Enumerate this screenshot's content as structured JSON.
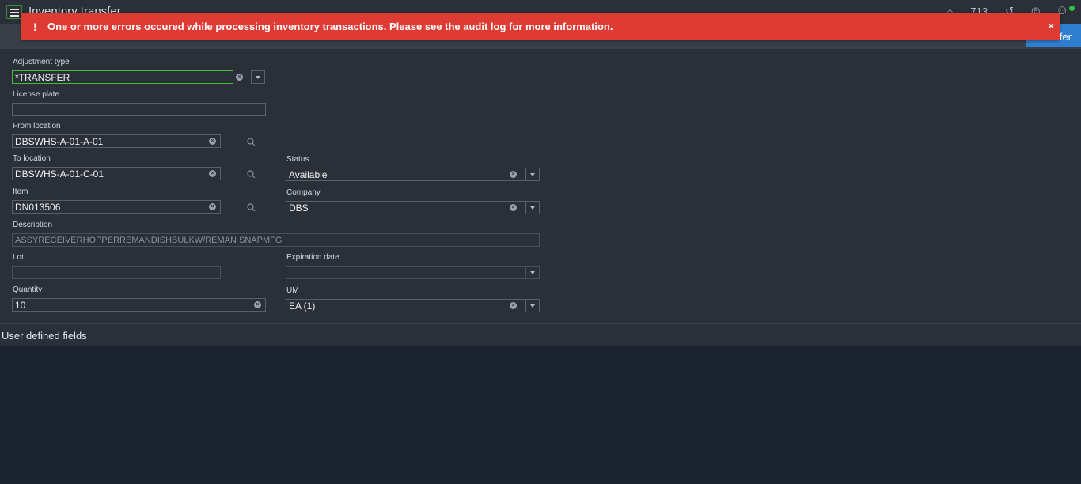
{
  "app": {
    "title": "Inventory transfer",
    "count": "713",
    "action_label": "fer"
  },
  "icons": {
    "menu": "hamburger-icon",
    "home": "home-icon",
    "history": "history-icon",
    "help": "help-icon",
    "user": "user-icon",
    "search": "search-icon",
    "clear": "clear-icon",
    "dropdown": "chevron-down-icon",
    "error": "exclamation-icon",
    "close": "close-icon"
  },
  "error": {
    "message": "One or more errors occured while processing inventory transactions. Please see the audit log for more information.",
    "icon": "!",
    "close": "×"
  },
  "form": {
    "adjustment_type": {
      "label": "Adjustment type",
      "value": "*TRANSFER"
    },
    "license_plate": {
      "label": "License plate",
      "value": ""
    },
    "from_location": {
      "label": "From location",
      "value": "DBSWHS-A-01-A-01"
    },
    "to_location": {
      "label": "To location",
      "value": "DBSWHS-A-01-C-01"
    },
    "status": {
      "label": "Status",
      "value": "Available"
    },
    "item": {
      "label": "Item",
      "value": "DN013506"
    },
    "company": {
      "label": "Company",
      "value": "DBS"
    },
    "description": {
      "label": "Description",
      "value": "ASSYRECEIVERHOPPERREMANDISHBULKW/REMAN SNAPMFG"
    },
    "lot": {
      "label": "Lot",
      "value": ""
    },
    "expiration_date": {
      "label": "Expiration date",
      "value": ""
    },
    "quantity": {
      "label": "Quantity",
      "value": "10"
    },
    "um": {
      "label": "UM",
      "value": "EA (1)"
    }
  },
  "section": {
    "title": "User defined fields"
  },
  "colors": {
    "error": "#dd3b33",
    "accent": "#2f7fd1",
    "focus": "#3bbf3b",
    "background": "#1c2330",
    "panel": "#2a2f38"
  }
}
